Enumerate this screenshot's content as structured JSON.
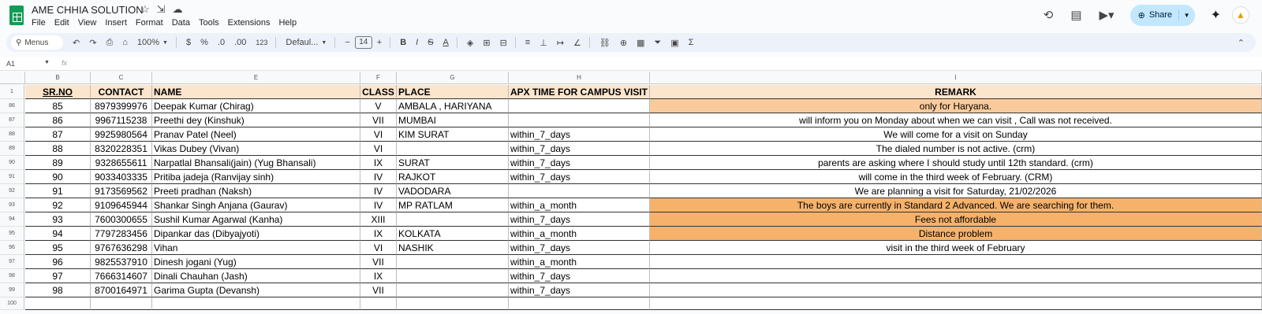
{
  "app": {
    "doc_title": "AME CHHIA SOLUTION",
    "menu": [
      "File",
      "Edit",
      "View",
      "Insert",
      "Format",
      "Data",
      "Tools",
      "Extensions",
      "Help"
    ],
    "share_label": "Share"
  },
  "toolbar": {
    "menus_label": "Menus",
    "zoom": "100%",
    "currency": "$",
    "percent": "%",
    "dec_decrease": ".0",
    "dec_increase": ".00",
    "number_format": "123",
    "font": "Defaul...",
    "font_size": "14"
  },
  "formula_bar": {
    "cell_ref": "A1",
    "fx": "fx"
  },
  "columns": [
    "B",
    "C",
    "E",
    "F",
    "G",
    "H",
    "I"
  ],
  "headers": {
    "srno": "SR.NO",
    "contact": "CONTACT",
    "name": "NAME",
    "class": "CLASS",
    "place": "PLACE",
    "time": "APX TIME FOR CAMPUS VISIT",
    "remark": "REMARK"
  },
  "row_numbers": [
    "1",
    "86",
    "87",
    "88",
    "89",
    "90",
    "91",
    "92",
    "93",
    "94",
    "95",
    "96",
    "97",
    "98",
    "99",
    "100"
  ],
  "rows": [
    {
      "sr": "85",
      "contact": "8979399976",
      "name": "Deepak Kumar (Chirag)",
      "class": "V",
      "place": "AMBALA , HARIYANA",
      "time": "",
      "remark": "only for Haryana.",
      "hl": "peach"
    },
    {
      "sr": "86",
      "contact": "9967115238",
      "name": "Preethi dey (Kinshuk)",
      "class": "VII",
      "place": "MUMBAI",
      "time": "",
      "remark": "will inform you on Monday about when we can visit   , Call was not received.",
      "hl": ""
    },
    {
      "sr": "87",
      "contact": "9925980564",
      "name": "Pranav Patel (Neel)",
      "class": "VI",
      "place": "KIM SURAT",
      "time": "within_7_days",
      "remark": "We will come for a visit on Sunday",
      "hl": ""
    },
    {
      "sr": "88",
      "contact": "8320228351",
      "name": "Vikas Dubey (Vivan)",
      "class": "VI",
      "place": "",
      "time": "within_7_days",
      "remark": "The dialed number is not active. (crm)",
      "hl": ""
    },
    {
      "sr": "89",
      "contact": "9328655611",
      "name": "Narpatlal Bhansali(jain) (Yug Bhansali)",
      "class": "IX",
      "place": "SURAT",
      "time": "within_7_days",
      "remark": "parents are asking where I should study until 12th standard. (crm)",
      "hl": ""
    },
    {
      "sr": "90",
      "contact": "9033403335",
      "name": "Pritiba jadeja (Ranvijay sinh)",
      "class": "IV",
      "place": "RAJKOT",
      "time": "within_7_days",
      "remark": "will come in the third week of February.  (CRM)",
      "hl": ""
    },
    {
      "sr": "91",
      "contact": "9173569562",
      "name": "Preeti pradhan (Naksh)",
      "class": "IV",
      "place": "VADODARA",
      "time": "",
      "remark": "We are planning a visit for Saturday, 21/02/2026",
      "hl": ""
    },
    {
      "sr": "92",
      "contact": "9109645944",
      "name": "Shankar Singh Anjana (Gaurav)",
      "class": "IV",
      "place": "MP RATLAM",
      "time": "within_a_month",
      "remark": "The boys are currently in Standard 2 Advanced. We are searching for them.",
      "hl": "orange"
    },
    {
      "sr": "93",
      "contact": "7600300655",
      "name": "Sushil Kumar Agarwal (Kanha)",
      "class": "XIII",
      "place": "",
      "time": "within_7_days",
      "remark": "Fees not affordable",
      "hl": "orange"
    },
    {
      "sr": "94",
      "contact": "7797283456",
      "name": "Dipankar das (Dibyajyoti)",
      "class": "IX",
      "place": "KOLKATA",
      "time": "within_a_month",
      "remark": "Distance problem",
      "hl": "orange"
    },
    {
      "sr": "95",
      "contact": "9767636298",
      "name": "Vihan",
      "class": "VI",
      "place": "NASHIK",
      "time": "within_7_days",
      "remark": "visit in the third week of February",
      "hl": ""
    },
    {
      "sr": "96",
      "contact": "9825537910",
      "name": "Dinesh jogani (Yug)",
      "class": "VII",
      "place": "",
      "time": "within_a_month",
      "remark": "",
      "hl": ""
    },
    {
      "sr": "97",
      "contact": "7666314607",
      "name": "Dinali Chauhan (Jash)",
      "class": "IX",
      "place": "",
      "time": "within_7_days",
      "remark": "",
      "hl": ""
    },
    {
      "sr": "98",
      "contact": "8700164971",
      "name": "Garima Gupta (Devansh)",
      "class": "VII",
      "place": "",
      "time": "within_7_days",
      "remark": "",
      "hl": ""
    }
  ],
  "colors": {
    "header_fill": "#fce5cd",
    "orange_fill": "#f6b26b",
    "peach_fill": "#f9cb9c",
    "share_bg": "#c2e7ff"
  }
}
